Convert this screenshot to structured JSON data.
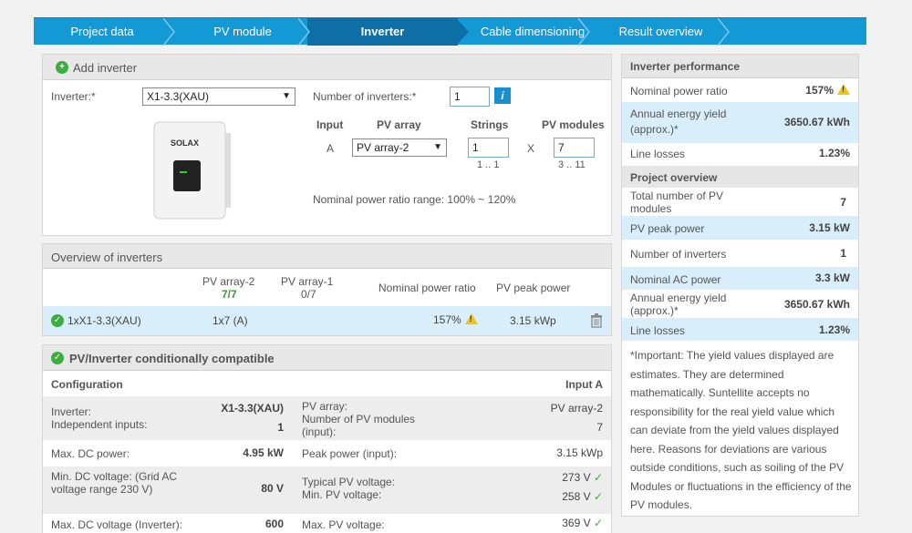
{
  "nav": {
    "tabs": [
      "Project data",
      "PV module",
      "Inverter",
      "Cable dimensioning",
      "Result overview"
    ],
    "active": "Inverter"
  },
  "add_inverter": {
    "header": "Add inverter",
    "inverter_label": "Inverter:*",
    "inverter_value": "X1-3.3(XAU)",
    "num_inverters_label": "Number of inverters:*",
    "num_inverters_value": "1",
    "info_icon": "i",
    "col_input": "Input",
    "col_pv_array": "PV array",
    "col_strings": "Strings",
    "col_pv_modules": "PV modules",
    "row_input": "A",
    "row_pv_array": "PV array-2",
    "row_strings": "1",
    "row_strings_range": "1 .. 1",
    "x_symbol": "X",
    "row_modules": "7",
    "row_modules_range": "3 .. 11",
    "nominal_range": "Nominal power ratio range: 100% ~ 120%",
    "brand_text": "SOLAX"
  },
  "overview": {
    "header": "Overview of inverters",
    "col_pv_array_2": "PV array-2",
    "col_pv_array_2_sub": "7/7",
    "col_pv_array_1": "PV array-1",
    "col_pv_array_1_sub": "0/7",
    "col_ratio": "Nominal power ratio",
    "col_peak": "PV peak power",
    "row_name": "1xX1-3.3(XAU)",
    "row_config": "1x7 (A)",
    "row_ratio": "157%",
    "row_peak": "3.15 kWp"
  },
  "compat": {
    "header": "PV/Inverter conditionally compatible",
    "configuration": "Configuration",
    "input_a": "Input A",
    "rows": [
      {
        "l1": "Inverter:",
        "l2": "Independent inputs:",
        "v1": "X1-3.3(XAU)",
        "v2": "1",
        "r1": "PV array:",
        "r2": "Number of PV modules (input):",
        "rv1": "PV array-2",
        "rv2": "7"
      },
      {
        "l1": "Max. DC power:",
        "v1": "4.95 kW",
        "r1": "Peak power (input):",
        "rv1": "3.15 kWp"
      },
      {
        "l1": "Min. DC voltage: (Grid AC voltage range 230 V)",
        "v1": "80 V",
        "r1": "Typical PV voltage:",
        "r2": "Min. PV voltage:",
        "rv1": "273 V",
        "rv2": "258 V"
      },
      {
        "l1": "Max. DC voltage (Inverter):",
        "v1": "600",
        "r1": "Max. PV voltage:",
        "rv1": "369 V"
      }
    ]
  },
  "performance": {
    "header": "Inverter performance",
    "rows": [
      {
        "label": "Nominal power ratio",
        "value": "157%"
      },
      {
        "label": "Annual energy yield (approx.)*",
        "value": "3650.67 kWh"
      },
      {
        "label": "Line losses",
        "value": "1.23%"
      }
    ]
  },
  "project_overview": {
    "header": "Project overview",
    "rows": [
      {
        "label": "Total number of PV modules",
        "value": "7"
      },
      {
        "label": "PV peak power",
        "value": "3.15 kW"
      },
      {
        "label": "Number of inverters",
        "value": "1"
      },
      {
        "label": "Nominal AC power",
        "value": "3.3 kW"
      },
      {
        "label": "Annual energy yield (approx.)*",
        "value": "3650.67 kWh"
      },
      {
        "label": "Line losses",
        "value": "1.23%"
      }
    ]
  },
  "note": {
    "lines": [
      "*Important: The yield values displayed are",
      "estimates. They are determined",
      "mathematically. Suntellite accepts no",
      "responsibility for the real yield value which",
      "can deviate from the yield values displayed",
      "here. Reasons for deviations are various",
      "outside conditions, such as soiling of the PV",
      "Modules or fluctuations in the efficiency of the",
      "PV modules."
    ]
  },
  "colors": {
    "nav": "#139ad6",
    "nav_active": "#0d6fa6",
    "highlight": "#d9eefb",
    "ok": "#3cae3f",
    "warn": "#f1c40f"
  }
}
